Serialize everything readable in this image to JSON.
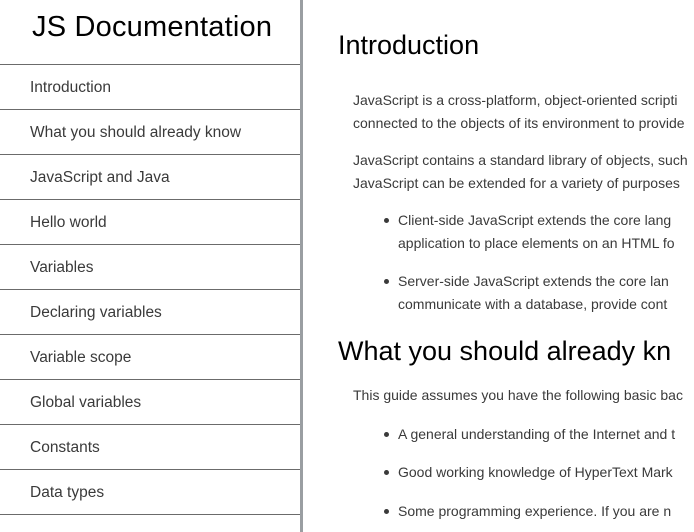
{
  "navbar": {
    "title": "JS Documentation",
    "items": [
      {
        "label": "Introduction"
      },
      {
        "label": "What you should already know"
      },
      {
        "label": "JavaScript and Java"
      },
      {
        "label": "Hello world"
      },
      {
        "label": "Variables"
      },
      {
        "label": "Declaring variables"
      },
      {
        "label": "Variable scope"
      },
      {
        "label": "Global variables"
      },
      {
        "label": "Constants"
      },
      {
        "label": "Data types"
      }
    ]
  },
  "main": {
    "intro": {
      "heading": "Introduction",
      "p1_line1": "JavaScript is a cross-platform, object-oriented scripti",
      "p1_line2": "connected to the objects of its environment to provide",
      "p2_line1": "JavaScript contains a standard library of objects, such",
      "p2_line2": "JavaScript can be extended for a variety of purposes",
      "bullets": [
        {
          "line1": "Client-side JavaScript extends the core lang",
          "line2": "application to place elements on an HTML fo"
        },
        {
          "line1": "Server-side JavaScript extends the core lan",
          "line2": "communicate with a database, provide cont"
        }
      ]
    },
    "know": {
      "heading": "What you should already kn",
      "p1": "This guide assumes you have the following basic bac",
      "bullets": [
        "A general understanding of the Internet and t",
        "Good working knowledge of HyperText Mark",
        "Some programming experience. If you are n"
      ]
    }
  }
}
